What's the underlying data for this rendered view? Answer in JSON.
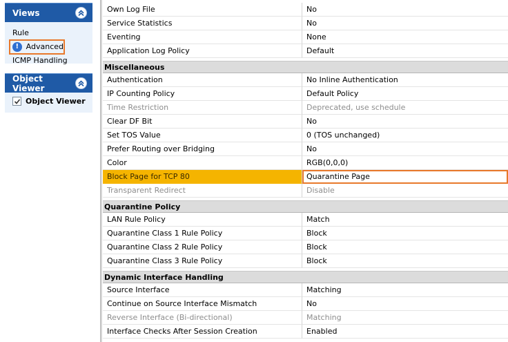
{
  "left": {
    "views": {
      "title": "Views",
      "items": [
        {
          "label": "Rule"
        },
        {
          "label": "Advanced",
          "highlighted": true,
          "icon": "info-icon"
        },
        {
          "label": "ICMP Handling"
        }
      ]
    },
    "object_viewer": {
      "title": "Object Viewer",
      "item_label": "Object Viewer",
      "checked": true
    }
  },
  "grid": {
    "top_rows": [
      {
        "name": "Own Log File",
        "value": "No"
      },
      {
        "name": "Service Statistics",
        "value": "No"
      },
      {
        "name": "Eventing",
        "value": "None"
      },
      {
        "name": "Application Log Policy",
        "value": "Default"
      }
    ],
    "sections": [
      {
        "title": "Miscellaneous",
        "rows": [
          {
            "name": "Authentication",
            "value": "No Inline Authentication"
          },
          {
            "name": "IP Counting Policy",
            "value": "Default Policy"
          },
          {
            "name": "Time Restriction",
            "value": "Deprecated, use schedule",
            "disabled": true
          },
          {
            "name": "Clear DF Bit",
            "value": "No"
          },
          {
            "name": "Set TOS Value",
            "value": "0 (TOS unchanged)"
          },
          {
            "name": "Prefer Routing over Bridging",
            "value": "No"
          },
          {
            "name": "Color",
            "value": "RGB(0,0,0)"
          },
          {
            "name": "Block Page for TCP 80",
            "value": "Quarantine Page",
            "selected": true
          },
          {
            "name": "Transparent Redirect",
            "value": "Disable",
            "disabled": true
          }
        ]
      },
      {
        "title": "Quarantine Policy",
        "rows": [
          {
            "name": "LAN Rule Policy",
            "value": "Match"
          },
          {
            "name": "Quarantine Class 1 Rule Policy",
            "value": "Block"
          },
          {
            "name": "Quarantine Class 2 Rule Policy",
            "value": "Block"
          },
          {
            "name": "Quarantine Class 3 Rule Policy",
            "value": "Block"
          }
        ]
      },
      {
        "title": "Dynamic Interface Handling",
        "rows": [
          {
            "name": "Source Interface",
            "value": "Matching"
          },
          {
            "name": "Continue on Source Interface Mismatch",
            "value": "No"
          },
          {
            "name": "Reverse Interface (Bi-directional)",
            "value": "Matching",
            "disabled": true
          },
          {
            "name": "Interface Checks After Session Creation",
            "value": "Enabled"
          }
        ]
      }
    ]
  },
  "colors": {
    "panel_header": "#1f5aa6",
    "selection": "#f5b400",
    "highlight_border": "#e8782a"
  }
}
